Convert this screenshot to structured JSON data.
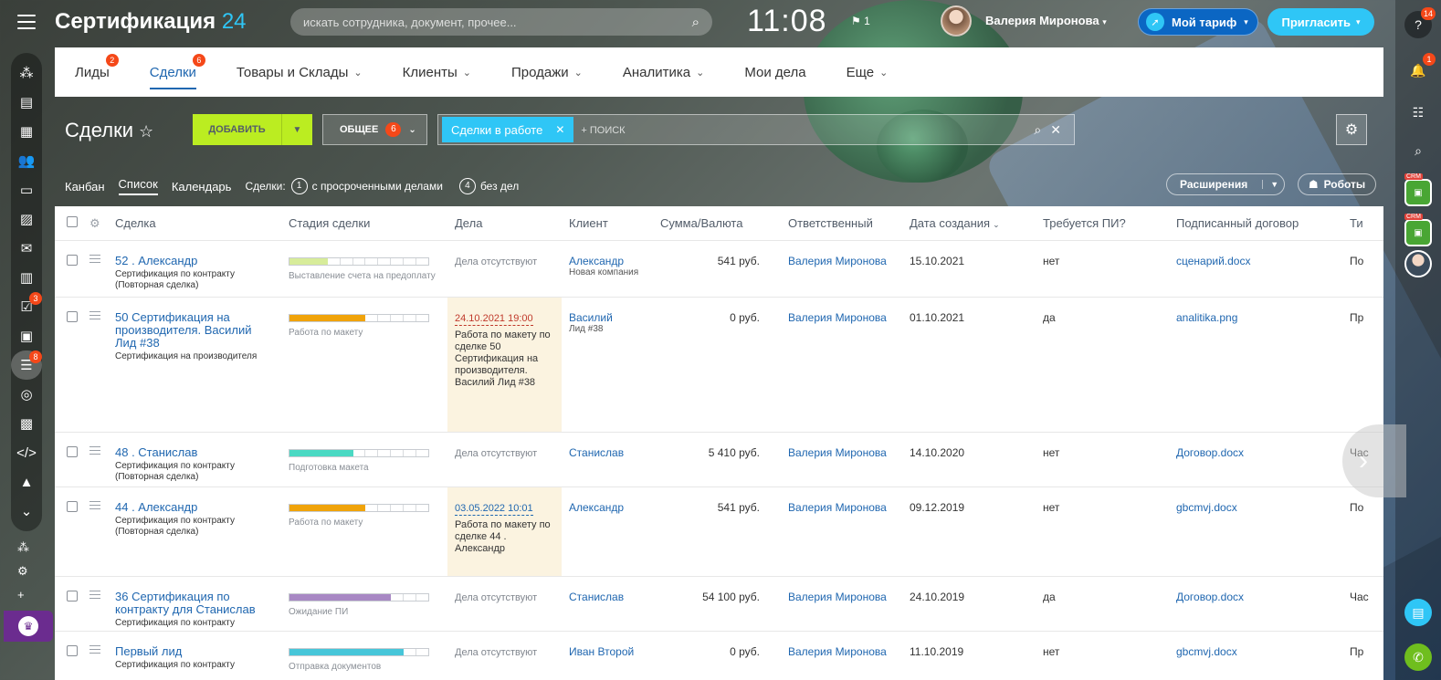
{
  "header": {
    "logo_main": "Сертификация",
    "logo_num": "24",
    "search_placeholder": "искать сотрудника, документ, прочее...",
    "clock": "11:08",
    "flag_count": "1",
    "user_name": "Валерия Миронова",
    "tariff_label": "Мой тариф",
    "invite_label": "Пригласить"
  },
  "left_sidebar": {
    "task_badge": "3",
    "funnel_badge": "8"
  },
  "right_sidebar": {
    "help_badge": "14",
    "bell_badge": "1",
    "crm_tag": "CRM"
  },
  "tabs": [
    {
      "label": "Лиды",
      "badge": "2"
    },
    {
      "label": "Сделки",
      "badge": "6"
    },
    {
      "label": "Товары и Склады"
    },
    {
      "label": "Клиенты"
    },
    {
      "label": "Продажи"
    },
    {
      "label": "Аналитика"
    },
    {
      "label": "Мои дела"
    },
    {
      "label": "Еще"
    }
  ],
  "toolbar": {
    "title": "Сделки",
    "add_label": "ДОБАВИТЬ",
    "general_label": "ОБЩЕЕ",
    "general_count": "6",
    "filter_tag": "Сделки в работе",
    "filter_placeholder": "+ поиск"
  },
  "views": {
    "kanban": "Канбан",
    "list": "Список",
    "calendar": "Календарь",
    "counters_label": "Сделки:",
    "overdue_count": "1",
    "overdue_label": "с просроченными делами",
    "noacts_count": "4",
    "noacts_label": "без дел",
    "extensions_label": "Расширения",
    "robots_label": "Роботы"
  },
  "grid": {
    "columns": {
      "deal": "Сделка",
      "stage": "Стадия сделки",
      "acts": "Дела",
      "client": "Клиент",
      "sum": "Сумма/Валюта",
      "resp": "Ответственный",
      "date": "Дата создания",
      "pi": "Требуется ПИ?",
      "contract": "Подписанный договор",
      "type": "Ти"
    },
    "rows": [
      {
        "title": "52 . Александр",
        "subtitle": "Сертификация по контракту (Повторная сделка)",
        "stage_label": "Выставление счета на предоплату",
        "acts_empty": "Дела отсутствуют",
        "client": "Александр",
        "client_sub": "Новая компания",
        "sum": "541 руб.",
        "resp": "Валерия Миронова",
        "date": "15.10.2021",
        "pi": "нет",
        "contract": "сценарий.docx",
        "type": "По"
      },
      {
        "title": "50 Сертификация на производителя. Василий Лид #38",
        "subtitle": "Сертификация на производителя",
        "stage_label": "Работа по макету",
        "act_date": "24.10.2021 19:00",
        "act_text": "Работа по макету по сделке 50 Сертификация на производителя. Василий Лид #38",
        "client": "Василий",
        "client_sub": "Лид #38",
        "sum": "0 руб.",
        "resp": "Валерия Миронова",
        "date": "01.10.2021",
        "pi": "да",
        "contract": "analitika.png",
        "type": "Пр"
      },
      {
        "title": "48 . Станислав",
        "subtitle": "Сертификация по контракту (Повторная сделка)",
        "stage_label": "Подготовка макета",
        "acts_empty": "Дела отсутствуют",
        "client": "Станислав",
        "sum": "5 410 руб.",
        "resp": "Валерия Миронова",
        "date": "14.10.2020",
        "pi": "нет",
        "contract": "Договор.docx",
        "type": "Час"
      },
      {
        "title": "44 . Александр",
        "subtitle": "Сертификация по контракту (Повторная сделка)",
        "stage_label": "Работа по макету",
        "act_date": "03.05.2022 10:01",
        "act_text": "Работа по макету по сделке 44 . Александр",
        "client": "Александр",
        "sum": "541 руб.",
        "resp": "Валерия Миронова",
        "date": "09.12.2019",
        "pi": "нет",
        "contract": "gbcmvj.docx",
        "type": "По"
      },
      {
        "title": "36 Сертификация по контракту для Станислав",
        "subtitle": "Сертификация по контракту",
        "stage_label": "Ожидание ПИ",
        "acts_empty": "Дела отсутствуют",
        "client": "Станислав",
        "sum": "54 100 руб.",
        "resp": "Валерия Миронова",
        "date": "24.10.2019",
        "pi": "да",
        "contract": "Договор.docx",
        "type": "Час"
      },
      {
        "title": "Первый лид",
        "subtitle": "Сертификация по контракту",
        "stage_label": "Отправка документов",
        "acts_empty": "Дела отсутствуют",
        "client": "Иван Второй",
        "sum": "0 руб.",
        "resp": "Валерия Миронова",
        "date": "11.10.2019",
        "pi": "нет",
        "contract": "gbcmvj.docx",
        "type": "Пр"
      }
    ]
  },
  "stage_colors": {
    "row0": "#d7ec9a",
    "row1": "#f0a30a",
    "row2": "#4ad9c3",
    "row3": "#f0a30a",
    "row4": "#a888c4",
    "row5": "#47c6d9"
  }
}
